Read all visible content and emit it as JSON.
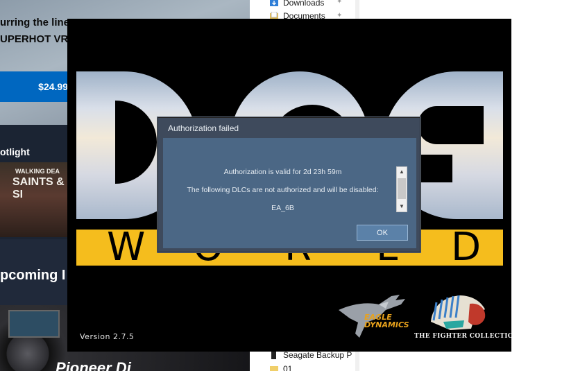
{
  "store": {
    "hero_line1": "urring the line",
    "hero_line2": "UPERHOT VR is",
    "price": "$24.99",
    "section_spotlight": "otlight",
    "game_tile_small": "WALKING DEA",
    "game_tile_big": "SAINTS & SI",
    "section_upcoming": "pcoming I",
    "dj_partial": "Pioneer Dj"
  },
  "explorer": {
    "items": [
      {
        "label": "Downloads",
        "icon": "download-folder-icon"
      },
      {
        "label": "Documents",
        "icon": "documents-folder-icon"
      },
      {
        "label": "Seagate Backup P",
        "icon": "drive-icon"
      },
      {
        "label": "01",
        "icon": "folder-icon"
      }
    ]
  },
  "splash": {
    "world_letters": [
      "W",
      "O",
      "R",
      "L",
      "D"
    ],
    "version": "Version  2.7.5",
    "eagle_line1": "EAGLE",
    "eagle_line2": "DYNAMICS",
    "fighter_collection": "THE FIGHTER COLLECTION"
  },
  "dialog": {
    "title": "Authorization failed",
    "line1": "Authorization is valid for 2d 23h 59m",
    "line2": "The following DLCs are not authorized and will be disabled:",
    "line3": "EA_6B",
    "ok_label": "OK"
  },
  "colors": {
    "dialog_frame": "#3e4a5c",
    "dialog_body": "#4b6785",
    "world_bar": "#f5bd1d",
    "price_button": "#0067c0",
    "ok_button": "#5b81a8"
  }
}
